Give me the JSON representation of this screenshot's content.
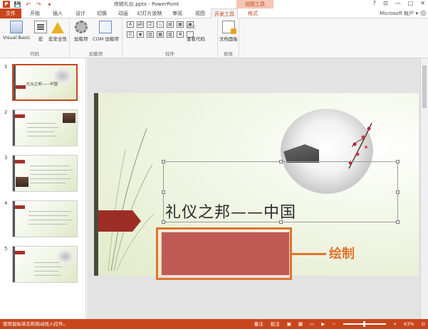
{
  "window": {
    "title": "传统礼仪.pptx - PowerPoint",
    "context_tab_group": "绘图工具",
    "controls": [
      "?",
      "⊡",
      "—",
      "□",
      "✕"
    ]
  },
  "qat": [
    "💾",
    "↶",
    "↷",
    "▾"
  ],
  "tabs": [
    {
      "label": "文件"
    },
    {
      "label": "开始"
    },
    {
      "label": "插入"
    },
    {
      "label": "设计"
    },
    {
      "label": "切换"
    },
    {
      "label": "动画"
    },
    {
      "label": "幻灯片放映"
    },
    {
      "label": "审阅"
    },
    {
      "label": "视图"
    },
    {
      "label": "开发工具"
    },
    {
      "label": "格式"
    }
  ],
  "account": "Microsoft 帐户 ▾",
  "ribbon": {
    "code_group": {
      "label": "代码",
      "buttons": [
        "Visual Basic",
        "宏",
        "宏安全性"
      ]
    },
    "addins_group": {
      "label": "加载项",
      "buttons": [
        "加载项",
        "COM 加载项"
      ]
    },
    "controls_group": {
      "label": "控件",
      "glyphs": [
        "A",
        "ab",
        "☑",
        "▭",
        "▤",
        "▦",
        "▣",
        "☑",
        "◉",
        "▥",
        "▦",
        "▧",
        "⊞",
        "⋮"
      ],
      "commands": [
        {
          "label": "属性",
          "enabled": false
        },
        {
          "label": "查看代码",
          "enabled": true
        }
      ]
    },
    "modify_group": {
      "label": "修改",
      "buttons": [
        "文档面板"
      ]
    }
  },
  "slides": [
    {
      "number": "1",
      "title": "礼仪之邦——中国",
      "selected": true
    },
    {
      "number": "2"
    },
    {
      "number": "3"
    },
    {
      "number": "4"
    },
    {
      "number": "5"
    }
  ],
  "slide": {
    "title": "礼仪之邦——中国",
    "drawn_fill": "#c05a55",
    "callout": "绘制"
  },
  "status": {
    "message": "使用鼠标单击和拖动插入控件。",
    "notes": "备注",
    "comments": "批注",
    "zoom": "63%"
  },
  "colors": {
    "accent": "#c9461d",
    "callout": "#e0732e",
    "arrow_tab": "#9e2e25"
  }
}
